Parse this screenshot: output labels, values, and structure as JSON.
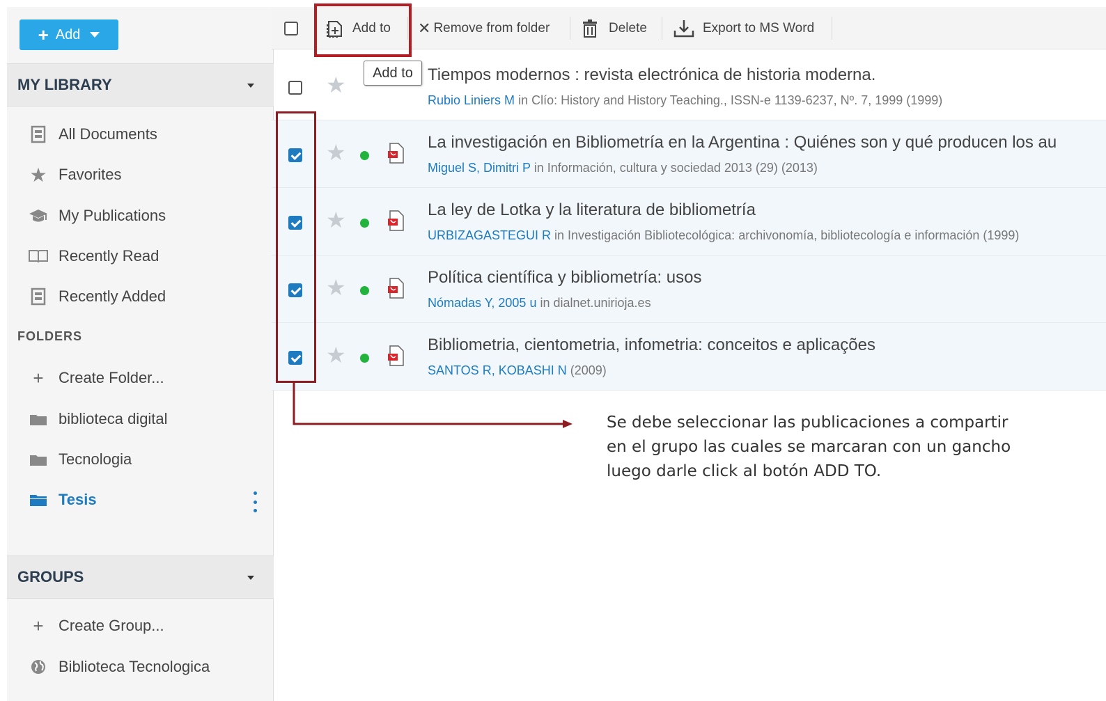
{
  "sidebar": {
    "add_label": "Add",
    "my_library": "MY LIBRARY",
    "items": [
      {
        "label": "All Documents",
        "icon": "document-icon"
      },
      {
        "label": "Favorites",
        "icon": "star-icon"
      },
      {
        "label": "My Publications",
        "icon": "graduation-cap-icon"
      },
      {
        "label": "Recently Read",
        "icon": "open-book-icon"
      },
      {
        "label": "Recently Added",
        "icon": "document-icon"
      }
    ],
    "folders_label": "FOLDERS",
    "folders": [
      {
        "label": "Create Folder...",
        "icon": "plus-icon"
      },
      {
        "label": "biblioteca digital",
        "icon": "folder-icon"
      },
      {
        "label": "Tecnologia",
        "icon": "folder-icon"
      },
      {
        "label": "Tesis",
        "icon": "folder-open-icon",
        "active": true
      }
    ],
    "groups": "GROUPS",
    "group_items": [
      {
        "label": "Create Group...",
        "icon": "plus-icon"
      },
      {
        "label": "Biblioteca Tecnologica",
        "icon": "globe-icon"
      }
    ]
  },
  "toolbar": {
    "add_to": "Add to",
    "remove": "Remove from folder",
    "delete": "Delete",
    "export": "Export to MS Word"
  },
  "tooltip": "Add to",
  "documents": [
    {
      "title": "Tiempos modernos : revista electrónica de historia moderna.",
      "authors": "Rubio Liniers M",
      "source": " in Clío: History and History Teaching., ISSN-e 1139-6237, Nº. 7, 1999 (1999)",
      "checked": false
    },
    {
      "title": "La investigación en Bibliometría en la Argentina : Quiénes son y qué producen los au",
      "authors": "Miguel S, Dimitri P",
      "source": " in Información, cultura y sociedad 2013 (29) (2013)",
      "checked": true
    },
    {
      "title": "La ley de Lotka y la literatura de bibliometría",
      "authors": "URBIZAGASTEGUI R",
      "source": " in Investigación Bibliotecológica: archivonomía, bibliotecología e información (1999)",
      "checked": true
    },
    {
      "title": "Política científica y bibliometría: usos",
      "authors": "Nómadas Y, 2005 u",
      "source": " in dialnet.unirioja.es",
      "checked": true
    },
    {
      "title": "Bibliometria, cientometria, infometria: conceitos e aplicações",
      "authors": "SANTOS R, KOBASHI N",
      "source": " (2009)",
      "checked": true
    }
  ],
  "annotation": {
    "line1": "Se debe seleccionar las publicaciones a compartir",
    "line2": "en el grupo las cuales se marcaran con un gancho",
    "line3": "luego darle click al botón ADD TO."
  },
  "colors": {
    "accent": "#2aa7e7",
    "link": "#1e7bc2",
    "highlight": "#b21e23",
    "status_dot": "#21b33b"
  }
}
